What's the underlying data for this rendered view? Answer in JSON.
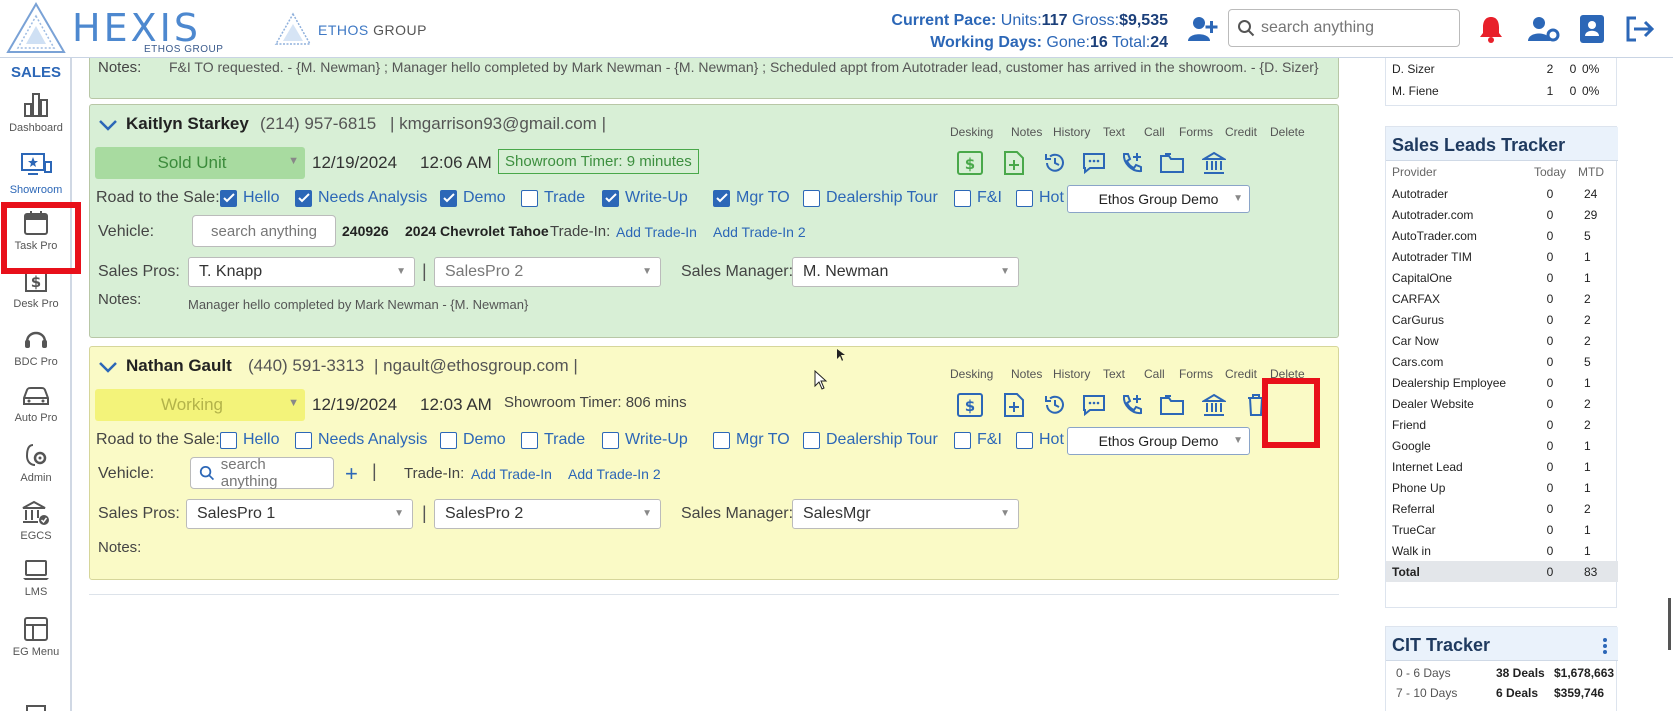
{
  "header": {
    "logo_text": "HEXIS",
    "logo_sub": "ETHOS GROUP",
    "ethos_logo_main": "ETHOS",
    "ethos_logo_sub": "GROUP",
    "current_pace_label": "Current Pace:",
    "units_label": "Units:",
    "units_value": "117",
    "gross_label": "Gross:",
    "gross_value": "$9,535",
    "working_days_label": "Working Days:",
    "gone_label": "Gone:",
    "gone_value": "16",
    "total_label": "Total:",
    "total_value": "24",
    "search_placeholder": "search anything",
    "icons": [
      "add-user-icon",
      "search-icon",
      "bell-icon",
      "user-settings-icon",
      "contact-card-icon",
      "logout-icon"
    ]
  },
  "sidebar": {
    "title": "SALES",
    "items": [
      {
        "label": "Dashboard",
        "icon": "bar-chart-icon"
      },
      {
        "label": "Showroom",
        "icon": "showroom-icon",
        "active": true
      },
      {
        "label": "Task Pro",
        "icon": "calendar-icon"
      },
      {
        "label": "Desk Pro",
        "icon": "dollar-icon"
      },
      {
        "label": "BDC Pro",
        "icon": "headset-icon"
      },
      {
        "label": "Auto Pro",
        "icon": "car-icon"
      },
      {
        "label": "Admin",
        "icon": "admin-gear-icon"
      },
      {
        "label": "EGCS",
        "icon": "bank-check-icon"
      },
      {
        "label": "LMS",
        "icon": "laptop-icon"
      },
      {
        "label": "EG Menu",
        "icon": "menu-grid-icon"
      }
    ]
  },
  "prev_card": {
    "notes_label": "Notes:",
    "notes_text": "F&I TO requested. - {M. Newman} ; Manager hello completed by Mark Newman - {M. Newman} ; Scheduled appt from Autotrader lead, customer has arrived in the showroom. - {D. Sizer}"
  },
  "action_labels": [
    "Desking",
    "Notes",
    "History",
    "Text",
    "Call",
    "Forms",
    "Credit",
    "Delete"
  ],
  "road_label": "Road to the Sale:",
  "steps": [
    "Hello",
    "Needs Analysis",
    "Demo",
    "Trade",
    "Write-Up",
    "Mgr TO",
    "Dealership Tour",
    "F&I",
    "Hot"
  ],
  "vehicle_label": "Vehicle:",
  "trade_in_label": "Trade-In:",
  "add_trade_in": "Add Trade-In",
  "add_trade_in_2": "Add Trade-In 2",
  "sales_pros_label": "Sales Pros:",
  "sales_manager_label": "Sales Manager:",
  "notes_label": "Notes:",
  "cards": [
    {
      "name": "Kaitlyn Starkey",
      "phone": "(214) 957-6815",
      "email": "| kmgarrison93@gmail.com |",
      "status": "Sold Unit",
      "date": "12/19/2024",
      "time": "12:06 AM",
      "timer": "Showroom Timer: 9 minutes",
      "checked": [
        true,
        true,
        true,
        false,
        true,
        true,
        false,
        false,
        false
      ],
      "dealer": "Ethos Group Demo",
      "vehicle_search": "search anything",
      "stock": "240926",
      "vehicle": "2024 Chevrolet Tahoe",
      "sales_pro_1": "T. Knapp",
      "sales_pro_2": "SalesPro 2",
      "sales_manager": "M. Newman",
      "notes": "Manager hello completed by Mark Newman - {M. Newman}"
    },
    {
      "name": "Nathan Gault",
      "phone": "(440) 591-3313",
      "email": "| ngault@ethosgroup.com |",
      "status": "Working",
      "date": "12/19/2024",
      "time": "12:03 AM",
      "timer": "Showroom Timer: 806 mins",
      "checked": [
        false,
        false,
        false,
        false,
        false,
        false,
        false,
        false,
        false
      ],
      "dealer": "Ethos Group Demo",
      "vehicle_search": "search anything",
      "sales_pro_1": "SalesPro 1",
      "sales_pro_2": "SalesPro 2",
      "sales_manager": "SalesMgr",
      "notes": ""
    }
  ],
  "top_table": [
    {
      "name": "D. Sizer",
      "a": "2",
      "b": "0",
      "c": "0%"
    },
    {
      "name": "M. Fiene",
      "a": "1",
      "b": "0",
      "c": "0%"
    }
  ],
  "leads": {
    "title": "Sales Leads Tracker",
    "col_provider": "Provider",
    "col_today": "Today",
    "col_mtd": "MTD",
    "rows": [
      [
        "Autotrader",
        "0",
        "24"
      ],
      [
        "Autotrader.com",
        "0",
        "29"
      ],
      [
        "AutoTrader.com",
        "0",
        "5"
      ],
      [
        "Autotrader TIM",
        "0",
        "1"
      ],
      [
        "CapitalOne",
        "0",
        "1"
      ],
      [
        "CARFAX",
        "0",
        "2"
      ],
      [
        "CarGurus",
        "0",
        "2"
      ],
      [
        "Car Now",
        "0",
        "2"
      ],
      [
        "Cars.com",
        "0",
        "5"
      ],
      [
        "Dealership Employee",
        "0",
        "1"
      ],
      [
        "Dealer Website",
        "0",
        "2"
      ],
      [
        "Friend",
        "0",
        "2"
      ],
      [
        "Google",
        "0",
        "1"
      ],
      [
        "Internet Lead",
        "0",
        "1"
      ],
      [
        "Phone Up",
        "0",
        "1"
      ],
      [
        "Referral",
        "0",
        "2"
      ],
      [
        "TrueCar",
        "0",
        "1"
      ],
      [
        "Walk in",
        "0",
        "1"
      ]
    ],
    "total": [
      "Total",
      "0",
      "83"
    ]
  },
  "cit": {
    "title": "CIT Tracker",
    "rows": [
      [
        "0 - 6 Days",
        "38 Deals",
        "$1,678,663"
      ],
      [
        "7 - 10 Days",
        "6 Deals",
        "$359,746"
      ]
    ]
  },
  "colors": {
    "accent": "#2c67b7",
    "sold_bg": "#a8dba0",
    "working_bg": "#f3f37a",
    "highlight": "#e8101a",
    "green_card": "#d8efd6",
    "yellow_card": "#fafac6"
  }
}
